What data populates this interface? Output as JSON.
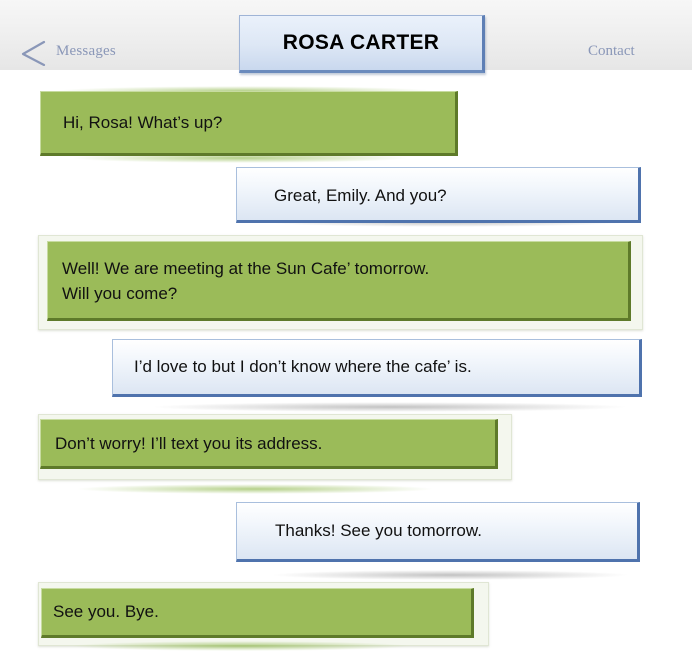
{
  "header": {
    "back_label": "Messages",
    "title": "ROSA CARTER",
    "contact_label": "Contact"
  },
  "messages": [
    {
      "sender": "Emily",
      "text": "Hi, Rosa! What’s up?"
    },
    {
      "sender": "Rosa",
      "text": "Great, Emily. And you?"
    },
    {
      "sender": "Emily",
      "text": "Well! We are meeting at the Sun Cafe’ tomorrow.\nWill you come?"
    },
    {
      "sender": "Rosa",
      "text": "I’d love to but I don’t know where the cafe’ is."
    },
    {
      "sender": "Emily",
      "text": "Don’t worry! I’ll text you its address."
    },
    {
      "sender": "Rosa",
      "text": "Thanks! See you tomorrow."
    },
    {
      "sender": "Emily",
      "text": "See you. Bye."
    }
  ],
  "colors": {
    "sent_bubble": "#9bbb59",
    "received_bubble": "#dce6f3",
    "header_link": "#8a97b8",
    "title_border": "#5e7fb5"
  },
  "icons": {
    "back": "chevron-left-icon"
  }
}
